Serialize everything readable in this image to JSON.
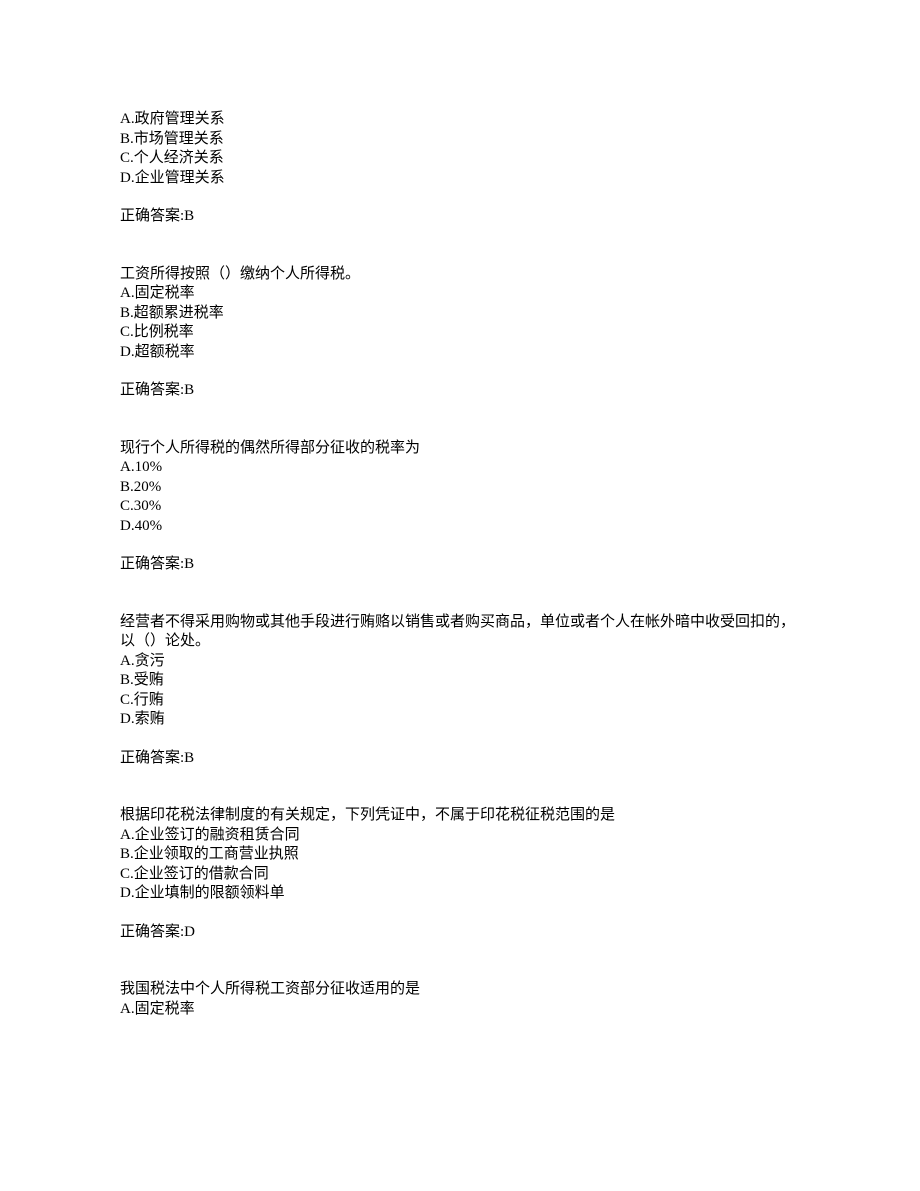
{
  "questions": [
    {
      "stem": "",
      "options": [
        "A.政府管理关系",
        "B.市场管理关系",
        "C.个人经济关系",
        "D.企业管理关系"
      ],
      "answer": "正确答案:B"
    },
    {
      "stem": "工资所得按照（）缴纳个人所得税。",
      "options": [
        "A.固定税率",
        "B.超额累进税率",
        "C.比例税率",
        "D.超额税率"
      ],
      "answer": "正确答案:B"
    },
    {
      "stem": "现行个人所得税的偶然所得部分征收的税率为",
      "options": [
        "A.10%",
        "B.20%",
        "C.30%",
        "D.40%"
      ],
      "answer": "正确答案:B"
    },
    {
      "stem": "经营者不得采用购物或其他手段进行贿赂以销售或者购买商品，单位或者个人在帐外暗中收受回扣的，以（）论处。",
      "options": [
        "A.贪污",
        "B.受贿",
        "C.行贿",
        "D.索贿"
      ],
      "answer": "正确答案:B"
    },
    {
      "stem": "根据印花税法律制度的有关规定，下列凭证中，不属于印花税征税范围的是",
      "options": [
        "A.企业签订的融资租赁合同",
        "B.企业领取的工商营业执照",
        "C.企业签订的借款合同",
        "D.企业填制的限额领料单"
      ],
      "answer": "正确答案:D"
    },
    {
      "stem": "我国税法中个人所得税工资部分征收适用的是",
      "options": [
        "A.固定税率"
      ],
      "answer": ""
    }
  ]
}
